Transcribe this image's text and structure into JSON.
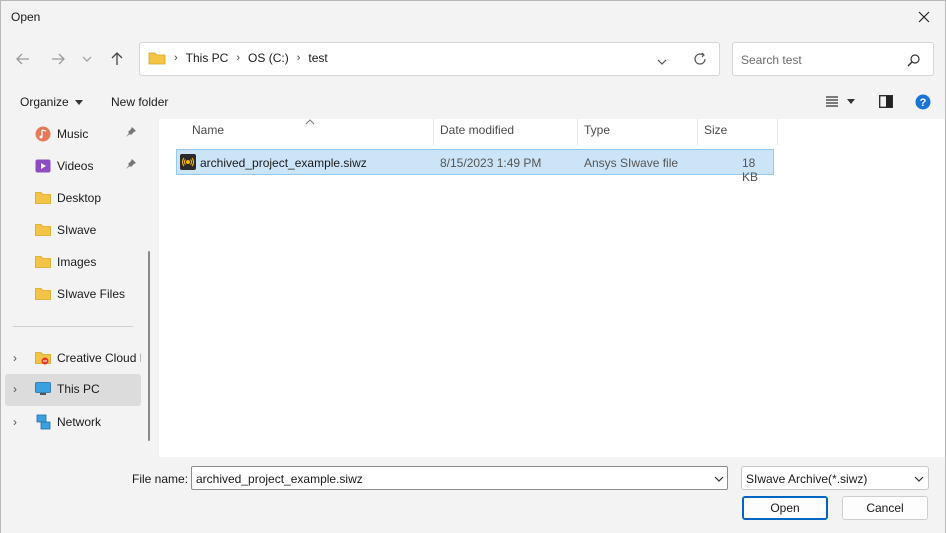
{
  "window": {
    "title": "Open"
  },
  "address": {
    "crumbs": [
      "This PC",
      "OS (C:)",
      "test"
    ]
  },
  "search": {
    "placeholder": "Search test"
  },
  "commandbar": {
    "organize": "Organize",
    "new_folder": "New folder"
  },
  "sidebar": {
    "items": [
      {
        "label": "Music",
        "icon": "music-icon",
        "pinned": true
      },
      {
        "label": "Videos",
        "icon": "videos-icon",
        "pinned": true
      },
      {
        "label": "Desktop",
        "icon": "folder-icon"
      },
      {
        "label": "SIwave",
        "icon": "folder-icon"
      },
      {
        "label": "Images",
        "icon": "folder-icon"
      },
      {
        "label": "SIwave Files",
        "icon": "folder-icon"
      }
    ],
    "roots": [
      {
        "label": "Creative Cloud Files",
        "icon": "creative-cloud-icon"
      },
      {
        "label": "This PC",
        "icon": "computer-icon",
        "selected": true
      },
      {
        "label": "Network",
        "icon": "network-icon"
      }
    ]
  },
  "filelist": {
    "columns": [
      "Name",
      "Date modified",
      "Type",
      "Size"
    ],
    "rows": [
      {
        "name": "archived_project_example.siwz",
        "date": "8/15/2023 1:49 PM",
        "type": "Ansys SIwave file",
        "size": "18 KB",
        "selected": true
      }
    ]
  },
  "footer": {
    "filename_label": "File name:",
    "filename_value": "archived_project_example.siwz",
    "filetype_value": "SIwave Archive(*.siwz)",
    "open_label": "Open",
    "cancel_label": "Cancel"
  },
  "colors": {
    "accent": "#0067c0",
    "selection": "#cce4f7",
    "folder": "#f4c545"
  }
}
